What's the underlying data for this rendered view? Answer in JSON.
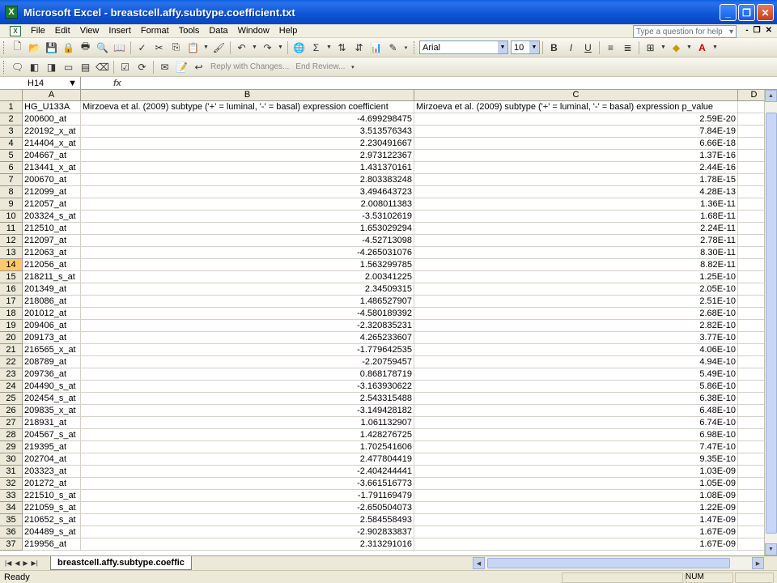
{
  "window": {
    "title": "Microsoft Excel - breastcell.affy.subtype.coefficient.txt",
    "app_icon": "X",
    "minimize": "_",
    "restore": "❐",
    "close": "✕"
  },
  "menu": {
    "items": [
      "File",
      "Edit",
      "View",
      "Insert",
      "Format",
      "Tools",
      "Data",
      "Window",
      "Help"
    ],
    "help_placeholder": "Type a question for help",
    "controls": [
      "-",
      "❐",
      "✕"
    ]
  },
  "toolbar": {
    "font_name": "Arial",
    "font_size": "10",
    "bold": "B",
    "italic": "I",
    "underline": "U",
    "reply_label": "Reply with Changes...",
    "end_review_label": "End Review..."
  },
  "formula_bar": {
    "name_box": "H14",
    "fx": "fx",
    "content": ""
  },
  "grid": {
    "columns": [
      "A",
      "B",
      "C",
      "D"
    ],
    "rows": [
      {
        "n": "1",
        "a": "HG_U133A",
        "b": "Mirzoeva et al. (2009) subtype ('+' = luminal, '-' = basal) expression coefficient",
        "c": "Mirzoeva et al. (2009) subtype ('+' = luminal, '-' = basal) expression p_value"
      },
      {
        "n": "2",
        "a": "200600_at",
        "b": "-4.699298475",
        "c": "2.59E-20"
      },
      {
        "n": "3",
        "a": "220192_x_at",
        "b": "3.513576343",
        "c": "7.84E-19"
      },
      {
        "n": "4",
        "a": "214404_x_at",
        "b": "2.230491667",
        "c": "6.66E-18"
      },
      {
        "n": "5",
        "a": "204667_at",
        "b": "2.973122367",
        "c": "1.37E-16"
      },
      {
        "n": "6",
        "a": "213441_x_at",
        "b": "1.431370161",
        "c": "2.44E-16"
      },
      {
        "n": "7",
        "a": "200670_at",
        "b": "2.803383248",
        "c": "1.78E-15"
      },
      {
        "n": "8",
        "a": "212099_at",
        "b": "3.494643723",
        "c": "4.28E-13"
      },
      {
        "n": "9",
        "a": "212057_at",
        "b": "2.008011383",
        "c": "1.36E-11"
      },
      {
        "n": "10",
        "a": "203324_s_at",
        "b": "-3.53102619",
        "c": "1.68E-11"
      },
      {
        "n": "11",
        "a": "212510_at",
        "b": "1.653029294",
        "c": "2.24E-11"
      },
      {
        "n": "12",
        "a": "212097_at",
        "b": "-4.52713098",
        "c": "2.78E-11"
      },
      {
        "n": "13",
        "a": "212063_at",
        "b": "-4.265031076",
        "c": "8.30E-11"
      },
      {
        "n": "14",
        "a": "212056_at",
        "b": "1.563299785",
        "c": "8.82E-11"
      },
      {
        "n": "15",
        "a": "218211_s_at",
        "b": "2.00341225",
        "c": "1.25E-10"
      },
      {
        "n": "16",
        "a": "201349_at",
        "b": "2.34509315",
        "c": "2.05E-10"
      },
      {
        "n": "17",
        "a": "218086_at",
        "b": "1.486527907",
        "c": "2.51E-10"
      },
      {
        "n": "18",
        "a": "201012_at",
        "b": "-4.580189392",
        "c": "2.68E-10"
      },
      {
        "n": "19",
        "a": "209406_at",
        "b": "-2.320835231",
        "c": "2.82E-10"
      },
      {
        "n": "20",
        "a": "209173_at",
        "b": "4.265233607",
        "c": "3.77E-10"
      },
      {
        "n": "21",
        "a": "216565_x_at",
        "b": "-1.779642535",
        "c": "4.06E-10"
      },
      {
        "n": "22",
        "a": "208789_at",
        "b": "-2.20759457",
        "c": "4.94E-10"
      },
      {
        "n": "23",
        "a": "209736_at",
        "b": "0.868178719",
        "c": "5.49E-10"
      },
      {
        "n": "24",
        "a": "204490_s_at",
        "b": "-3.163930622",
        "c": "5.86E-10"
      },
      {
        "n": "25",
        "a": "202454_s_at",
        "b": "2.543315488",
        "c": "6.38E-10"
      },
      {
        "n": "26",
        "a": "209835_x_at",
        "b": "-3.149428182",
        "c": "6.48E-10"
      },
      {
        "n": "27",
        "a": "218931_at",
        "b": "1.061132907",
        "c": "6.74E-10"
      },
      {
        "n": "28",
        "a": "204567_s_at",
        "b": "1.428276725",
        "c": "6.98E-10"
      },
      {
        "n": "29",
        "a": "219395_at",
        "b": "1.702541606",
        "c": "7.47E-10"
      },
      {
        "n": "30",
        "a": "202704_at",
        "b": "2.477804419",
        "c": "9.35E-10"
      },
      {
        "n": "31",
        "a": "203323_at",
        "b": "-2.404244441",
        "c": "1.03E-09"
      },
      {
        "n": "32",
        "a": "201272_at",
        "b": "-3.661516773",
        "c": "1.05E-09"
      },
      {
        "n": "33",
        "a": "221510_s_at",
        "b": "-1.791169479",
        "c": "1.08E-09"
      },
      {
        "n": "34",
        "a": "221059_s_at",
        "b": "-2.650504073",
        "c": "1.22E-09"
      },
      {
        "n": "35",
        "a": "210652_s_at",
        "b": "2.584558493",
        "c": "1.47E-09"
      },
      {
        "n": "36",
        "a": "204489_s_at",
        "b": "-2.902833837",
        "c": "1.67E-09"
      },
      {
        "n": "37",
        "a": "219956_at",
        "b": "2.313291016",
        "c": "1.67E-09"
      }
    ],
    "active_row": "14"
  },
  "sheet": {
    "tab_label": "breastcell.affy.subtype.coeffic"
  },
  "status": {
    "text": "Ready",
    "num": "NUM"
  }
}
